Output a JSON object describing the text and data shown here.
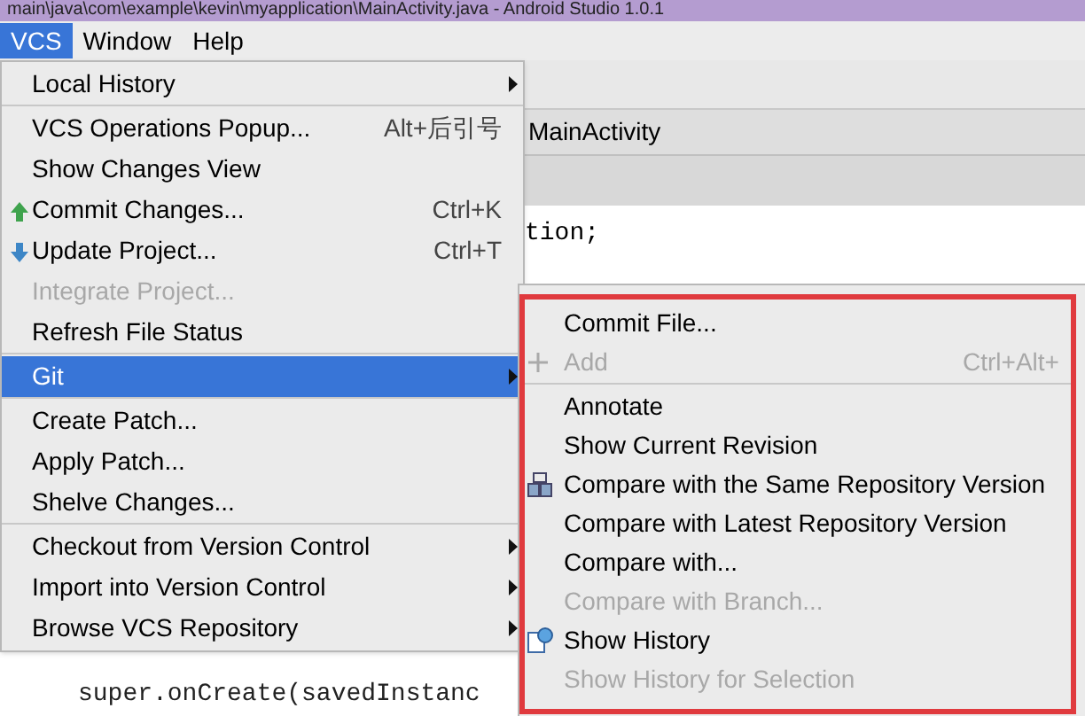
{
  "window": {
    "title": "main\\java\\com\\example\\kevin\\myapplication\\MainActivity.java - Android Studio 1.0.1"
  },
  "menubar": [
    {
      "label": "VCS",
      "selected": true
    },
    {
      "label": "Window",
      "selected": false
    },
    {
      "label": "Help",
      "selected": false
    }
  ],
  "editor": {
    "breadcrumb": "MainActivity",
    "code": [
      "tion;",
      "super.onCreate(savedInstanc"
    ]
  },
  "vcs_menu": [
    [
      {
        "label": "Local History",
        "submenu": true,
        "disabled": false,
        "selected": false
      }
    ],
    [
      {
        "label": "VCS Operations Popup...",
        "shortcut": "Alt+后引号",
        "submenu": false,
        "disabled": false,
        "selected": false
      },
      {
        "label": "Show Changes View",
        "submenu": false,
        "disabled": false,
        "selected": false
      },
      {
        "label": "Commit Changes...",
        "shortcut": "Ctrl+K",
        "kind": "commit",
        "submenu": false,
        "disabled": false,
        "selected": false
      },
      {
        "label": "Update Project...",
        "shortcut": "Ctrl+T",
        "kind": "update",
        "submenu": false,
        "disabled": false,
        "selected": false
      },
      {
        "label": "Integrate Project...",
        "submenu": false,
        "disabled": true,
        "selected": false
      },
      {
        "label": "Refresh File Status",
        "submenu": false,
        "disabled": false,
        "selected": false
      }
    ],
    [
      {
        "label": "Git",
        "submenu": true,
        "disabled": false,
        "selected": true
      }
    ],
    [
      {
        "label": "Create Patch...",
        "submenu": false,
        "disabled": false,
        "selected": false
      },
      {
        "label": "Apply Patch...",
        "submenu": false,
        "disabled": false,
        "selected": false
      },
      {
        "label": "Shelve Changes...",
        "submenu": false,
        "disabled": false,
        "selected": false
      }
    ],
    [
      {
        "label": "Checkout from Version Control",
        "submenu": true,
        "disabled": false,
        "selected": false
      },
      {
        "label": "Import into Version Control",
        "submenu": true,
        "disabled": false,
        "selected": false
      },
      {
        "label": "Browse VCS Repository",
        "submenu": true,
        "disabled": false,
        "selected": false
      }
    ]
  ],
  "git_submenu": [
    [
      {
        "label": "Commit File...",
        "disabled": false
      },
      {
        "label": "Add",
        "shortcut": "Ctrl+Alt+",
        "kind": "plus",
        "disabled": true
      }
    ],
    [
      {
        "label": "Annotate",
        "disabled": false
      },
      {
        "label": "Show Current Revision",
        "disabled": false
      },
      {
        "label": "Compare with the Same Repository Version",
        "kind": "compare",
        "disabled": false
      },
      {
        "label": "Compare with Latest Repository Version",
        "disabled": false
      },
      {
        "label": "Compare with...",
        "disabled": false
      },
      {
        "label": "Compare with Branch...",
        "disabled": true
      },
      {
        "label": "Show History",
        "kind": "history",
        "disabled": false
      },
      {
        "label": "Show History for Selection",
        "disabled": true
      }
    ]
  ]
}
